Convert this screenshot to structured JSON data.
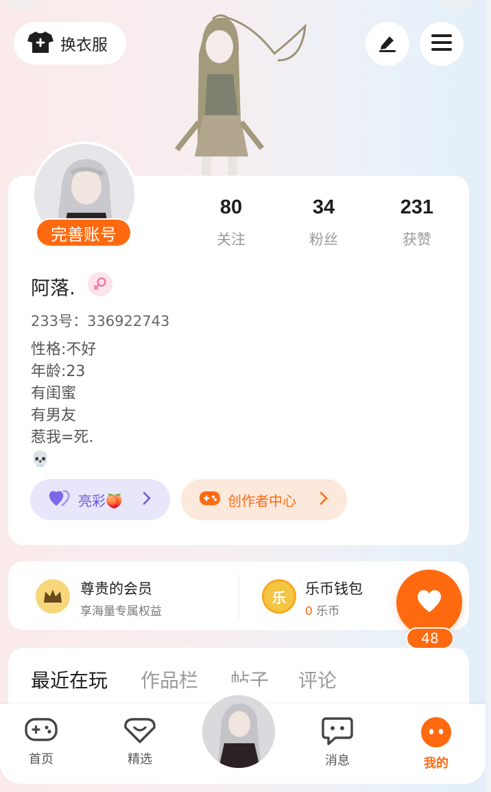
{
  "header": {
    "outfit_label": "换衣服",
    "icons": [
      "tshirt-icon",
      "edit-icon",
      "menu-icon"
    ]
  },
  "profile": {
    "complete_account_label": "完善账号",
    "stats": [
      {
        "value": "80",
        "label": "关注"
      },
      {
        "value": "34",
        "label": "粉丝"
      },
      {
        "value": "231",
        "label": "获赞"
      }
    ],
    "name": "阿落.",
    "gender_icon": "female-icon",
    "uid": "233号：336922743",
    "bio_lines": [
      "性格:不好",
      "年龄:23",
      "有闺蜜",
      "有男友",
      "惹我=死.",
      "💀"
    ],
    "pills": {
      "highlight_label": "亮彩🍑",
      "creator_label": "创作者中心"
    }
  },
  "member": {
    "vip_title": "尊贵的会员",
    "vip_subtitle": "享海量专属权益",
    "wallet_title": "乐币钱包",
    "wallet_amount": "0",
    "wallet_unit": "乐币",
    "coin_char": "乐"
  },
  "likes": {
    "count": "48"
  },
  "tabs": [
    "最近在玩",
    "作品栏",
    "帖子",
    "评论"
  ],
  "bottom_nav": [
    {
      "label": "首页",
      "icon": "gamepad-icon"
    },
    {
      "label": "精选",
      "icon": "heart-badge-icon"
    },
    {
      "label": "消息",
      "icon": "chat-icon"
    },
    {
      "label": "我的",
      "icon": "face-icon"
    }
  ],
  "colors": {
    "accent": "#ff6a10",
    "purple": "#6a5cd9",
    "gold": "#f4c542"
  }
}
